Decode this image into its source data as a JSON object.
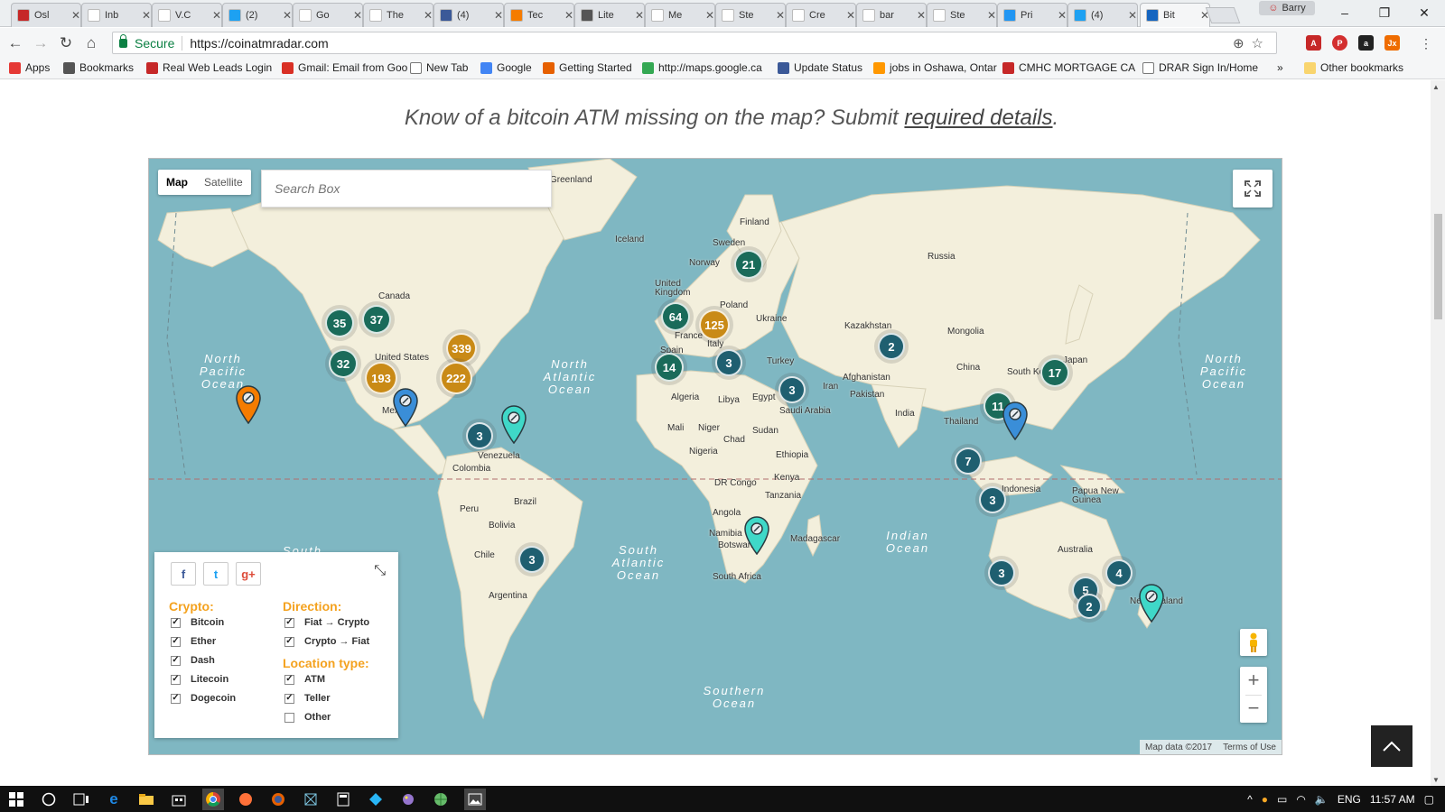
{
  "browser": {
    "tabs": [
      {
        "label": "Osl",
        "color": "#c62828",
        "glyph": "V"
      },
      {
        "label": "Inb",
        "color": "#ffffff",
        "glyph": "M"
      },
      {
        "label": "V.C",
        "color": "#ffffff",
        "glyph": "W"
      },
      {
        "label": "(2)",
        "color": "#1da1f2",
        "glyph": "t"
      },
      {
        "label": "Go",
        "color": "#ffffff",
        "glyph": "car"
      },
      {
        "label": "The",
        "color": "#ffffff",
        "glyph": "W"
      },
      {
        "label": "(4)",
        "color": "#3b5998",
        "glyph": "f"
      },
      {
        "label": "Tec",
        "color": "#f57c00",
        "glyph": "▶"
      },
      {
        "label": "Lite",
        "color": "#555555",
        "glyph": "Ł"
      },
      {
        "label": "Me",
        "color": "#ffffff",
        "glyph": "W"
      },
      {
        "label": "Ste",
        "color": "#ffffff",
        "glyph": "doc"
      },
      {
        "label": "Cre",
        "color": "#ffffff",
        "glyph": "W"
      },
      {
        "label": "bar",
        "color": "#ffffff",
        "glyph": "W"
      },
      {
        "label": "Ste",
        "color": "#ffffff",
        "glyph": "steem"
      },
      {
        "label": "Pri",
        "color": "#2196f3",
        "glyph": "B"
      },
      {
        "label": "(4)",
        "color": "#1da1f2",
        "glyph": "t"
      },
      {
        "label": "Bit",
        "color": "#1565c0",
        "glyph": "btc",
        "active": true
      }
    ],
    "profile_name": "Barry",
    "omnibox": {
      "secure_label": "Secure",
      "url": "https://coinatmradar.com"
    },
    "bookmarks": [
      {
        "label": "Apps",
        "icon": "apps-grid-icon"
      },
      {
        "label": "Bookmarks",
        "icon": "star-icon"
      },
      {
        "label": "Real Web Leads Login",
        "icon": "leads-icon"
      },
      {
        "label": "Gmail: Email from Goo",
        "icon": "gmail-icon"
      },
      {
        "label": "New Tab",
        "icon": "page-icon"
      },
      {
        "label": "Google",
        "icon": "google-icon"
      },
      {
        "label": "Getting Started",
        "icon": "firefox-icon"
      },
      {
        "label": "http://maps.google.ca",
        "icon": "maps-icon"
      },
      {
        "label": "Update Status",
        "icon": "facebook-icon"
      },
      {
        "label": "jobs in Oshawa, Ontar",
        "icon": "e-icon"
      },
      {
        "label": "CMHC MORTGAGE CA",
        "icon": "cmhc-icon"
      },
      {
        "label": "DRAR Sign In/Home",
        "icon": "page-icon"
      }
    ],
    "bookmarks_overflow": "»",
    "other_bookmarks": "Other bookmarks"
  },
  "page": {
    "headline_prefix": "Know of a bitcoin ATM missing on the map? Submit ",
    "headline_link": "required details",
    "headline_suffix": "."
  },
  "map": {
    "map_type": {
      "map": "Map",
      "satellite": "Satellite",
      "selected": "Map"
    },
    "search_placeholder": "Search Box",
    "attribution": {
      "data": "Map data ©2017",
      "terms": "Terms of Use"
    },
    "country_labels": [
      "Greenland",
      "Finland",
      "Iceland",
      "Sweden",
      "Norway",
      "Russia",
      "United Kingdom",
      "Poland",
      "Canada",
      "Ukraine",
      "France",
      "Kazakhstan",
      "Mongolia",
      "Italy",
      "Spain",
      "Turkey",
      "United States",
      "China",
      "South Korea",
      "Japan",
      "Afghanistan",
      "Iran",
      "Algeria",
      "Libya",
      "Egypt",
      "Pakistan",
      "Saudi Arabia",
      "India",
      "Thailand",
      "Mexico",
      "Mali",
      "Niger",
      "Sudan",
      "Chad",
      "Venezuela",
      "Nigeria",
      "Ethiopia",
      "Colombia",
      "Kenya",
      "DR Congo",
      "Indonesia",
      "Papua New Guinea",
      "Tanzania",
      "Brazil",
      "Peru",
      "Angola",
      "Bolivia",
      "Namibia",
      "Botswana",
      "Madagascar",
      "Australia",
      "Chile",
      "South Africa",
      "Argentina",
      "New Zealand"
    ],
    "ocean_labels": [
      "North Pacific Ocean",
      "North Atlantic Ocean",
      "South Atlantic Ocean",
      "Indian Ocean",
      "Southern Ocean",
      "North Pacific Ocean",
      "South"
    ],
    "clusters": [
      {
        "count": "21",
        "color": "#1a6b5a"
      },
      {
        "count": "35",
        "color": "#1a6b5a"
      },
      {
        "count": "37",
        "color": "#1a6b5a"
      },
      {
        "count": "64",
        "color": "#1a6b5a"
      },
      {
        "count": "125",
        "color": "#c98a16"
      },
      {
        "count": "339",
        "color": "#c98a16"
      },
      {
        "count": "32",
        "color": "#1a6b5a"
      },
      {
        "count": "193",
        "color": "#c98a16"
      },
      {
        "count": "222",
        "color": "#c98a16"
      },
      {
        "count": "14",
        "color": "#1a6b5a"
      },
      {
        "count": "3",
        "color": "#1f5f70"
      },
      {
        "count": "2",
        "color": "#1f5f70"
      },
      {
        "count": "17",
        "color": "#1a6b5a"
      },
      {
        "count": "3",
        "color": "#1f5f70"
      },
      {
        "count": "11",
        "color": "#1a6b5a"
      },
      {
        "count": "3",
        "color": "#1f5f70"
      },
      {
        "count": "7",
        "color": "#1f5f70"
      },
      {
        "count": "3",
        "color": "#1f5f70"
      },
      {
        "count": "3",
        "color": "#1f5f70"
      },
      {
        "count": "3",
        "color": "#1f5f70"
      },
      {
        "count": "4",
        "color": "#1f5f70"
      },
      {
        "count": "5",
        "color": "#1f5f70"
      },
      {
        "count": "2",
        "color": "#1f5f70"
      }
    ],
    "pins": [
      {
        "color": "#f57c00",
        "icon": "atm-pin-icon"
      },
      {
        "color": "#3a8ed8",
        "icon": "atm-pin-icon"
      },
      {
        "color": "#3fd8c8",
        "icon": "atm-pin-icon"
      },
      {
        "color": "#3fd8c8",
        "icon": "atm-pin-icon"
      },
      {
        "color": "#3a8ed8",
        "icon": "atm-pin-icon"
      },
      {
        "color": "#3fd8c8",
        "icon": "atm-pin-icon"
      }
    ]
  },
  "filters": {
    "crypto_heading": "Crypto:",
    "crypto": [
      {
        "label": "Bitcoin",
        "checked": true
      },
      {
        "label": "Ether",
        "checked": true
      },
      {
        "label": "Dash",
        "checked": true
      },
      {
        "label": "Litecoin",
        "checked": true
      },
      {
        "label": "Dogecoin",
        "checked": true
      }
    ],
    "direction_heading": "Direction:",
    "direction": [
      {
        "label": "Fiat → Crypto",
        "checked": true
      },
      {
        "label": "Crypto → Fiat",
        "checked": true
      }
    ],
    "location_heading": "Location type:",
    "location": [
      {
        "label": "ATM",
        "checked": true
      },
      {
        "label": "Teller",
        "checked": true
      },
      {
        "label": "Other",
        "checked": false
      }
    ],
    "share_labels": [
      "f",
      "t",
      "g+"
    ]
  },
  "taskbar": {
    "language": "ENG",
    "time": "11:57 AM"
  }
}
